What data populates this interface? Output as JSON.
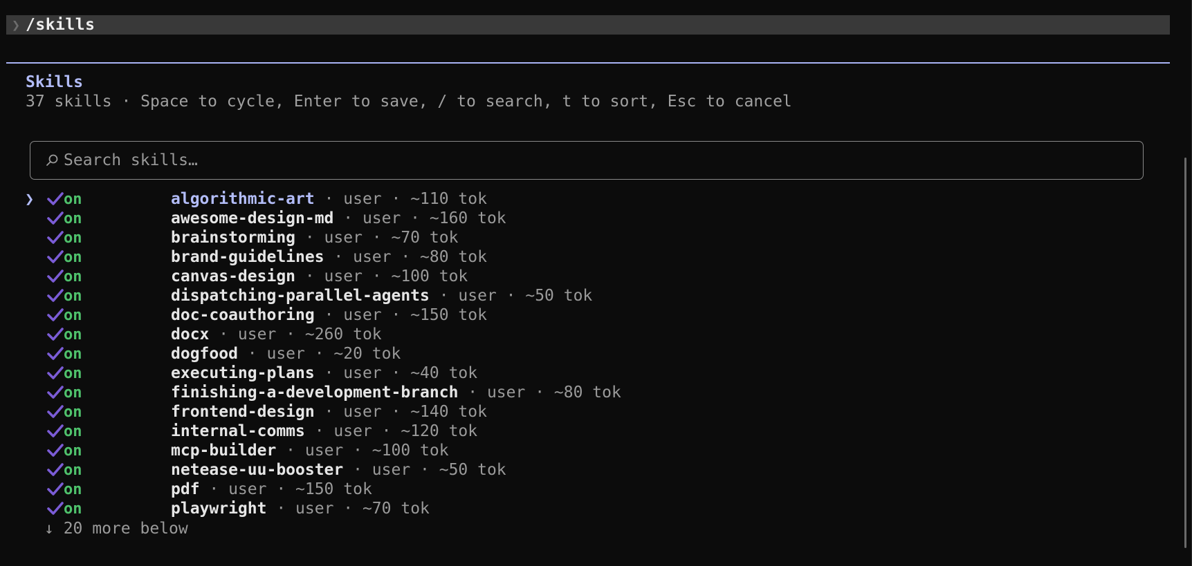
{
  "command": {
    "prompt_symbol": "❯",
    "text": "/skills"
  },
  "panel": {
    "title": "Skills",
    "subtitle": "37 skills · Space to cycle, Enter to save, / to search, t to sort, Esc to cancel"
  },
  "search": {
    "placeholder": "Search skills…",
    "value": ""
  },
  "cursor_symbol": "❯",
  "skills": [
    {
      "state": "on",
      "name": "algorithmic-art",
      "meta": " · user · ~110 tok",
      "selected": true
    },
    {
      "state": "on",
      "name": "awesome-design-md",
      "meta": " · user · ~160 tok"
    },
    {
      "state": "on",
      "name": "brainstorming",
      "meta": " · user · ~70 tok"
    },
    {
      "state": "on",
      "name": "brand-guidelines",
      "meta": " · user · ~80 tok"
    },
    {
      "state": "on",
      "name": "canvas-design",
      "meta": " · user · ~100 tok"
    },
    {
      "state": "on",
      "name": "dispatching-parallel-agents",
      "meta": " · user · ~50 tok"
    },
    {
      "state": "on",
      "name": "doc-coauthoring",
      "meta": " · user · ~150 tok"
    },
    {
      "state": "on",
      "name": "docx",
      "meta": " · user · ~260 tok"
    },
    {
      "state": "on",
      "name": "dogfood",
      "meta": " · user · ~20 tok"
    },
    {
      "state": "on",
      "name": "executing-plans",
      "meta": " · user · ~40 tok"
    },
    {
      "state": "on",
      "name": "finishing-a-development-branch",
      "meta": " · user · ~80 tok"
    },
    {
      "state": "on",
      "name": "frontend-design",
      "meta": " · user · ~140 tok"
    },
    {
      "state": "on",
      "name": "internal-comms",
      "meta": " · user · ~120 tok"
    },
    {
      "state": "on",
      "name": "mcp-builder",
      "meta": " · user · ~100 tok"
    },
    {
      "state": "on",
      "name": "netease-uu-booster",
      "meta": " · user · ~50 tok"
    },
    {
      "state": "on",
      "name": "pdf",
      "meta": " · user · ~150 tok"
    },
    {
      "state": "on",
      "name": "playwright",
      "meta": " · user · ~70 tok"
    }
  ],
  "more_below": "↓ 20 more below",
  "icons": {
    "search": "search-icon",
    "check": "check-icon"
  },
  "colors": {
    "accent": "#b3bdf9",
    "check": "#7b5cd6",
    "on": "#4fc26c",
    "muted": "#9a9a9a",
    "background": "#0c0c0c"
  }
}
